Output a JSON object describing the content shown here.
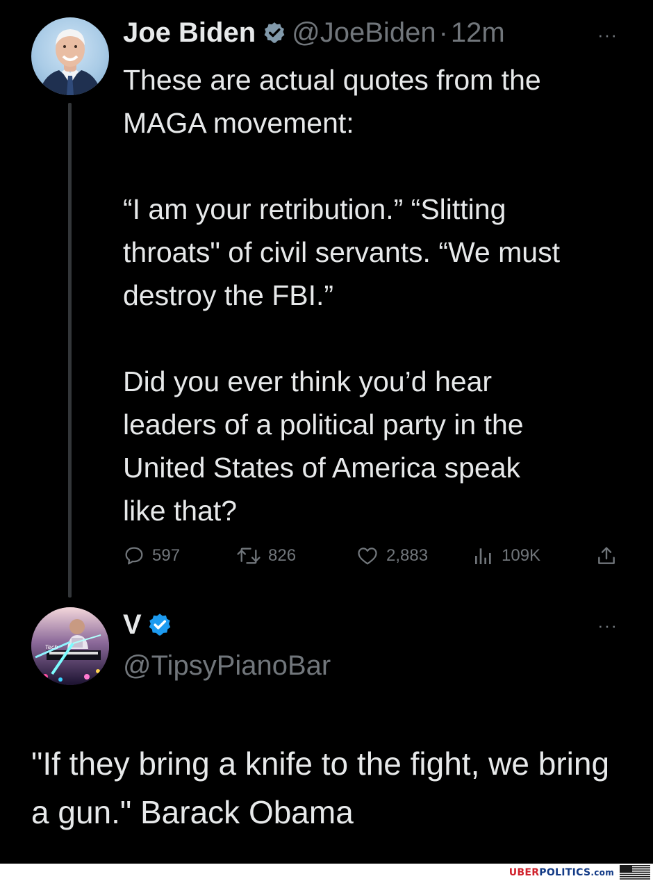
{
  "tweet": {
    "author_name": "Joe Biden",
    "handle": "@JoeBiden",
    "separator": "·",
    "time": "12m",
    "more_label": "···",
    "text": "These are actual quotes from the\nMAGA movement:\n\n“I am your retribution.” “Slitting\nthroats\" of civil servants. “We must\ndestroy the FBI.”\n\nDid you ever think you’d hear\nleaders of a political party in the\nUnited States of America speak\nlike that?",
    "replies": "597",
    "reposts": "826",
    "likes": "2,883",
    "views": "109K"
  },
  "reply": {
    "author_name": "V",
    "handle": "@TipsyPianoBar",
    "more_label": "···",
    "text": "\"If they bring a knife to the fight, we bring a gun.\" Barack Obama",
    "avatar_caption": "Tech"
  },
  "footer": {
    "brand_uber": "UBER",
    "brand_politics": "POLITICS",
    "brand_com": ".com"
  },
  "colors": {
    "background": "#000000",
    "text": "#e7e9ea",
    "muted": "#71767b",
    "verified_blue": "#1d9bf0",
    "verified_gray": "#829aab",
    "brand_red": "#d0212b",
    "brand_blue": "#123a86"
  }
}
